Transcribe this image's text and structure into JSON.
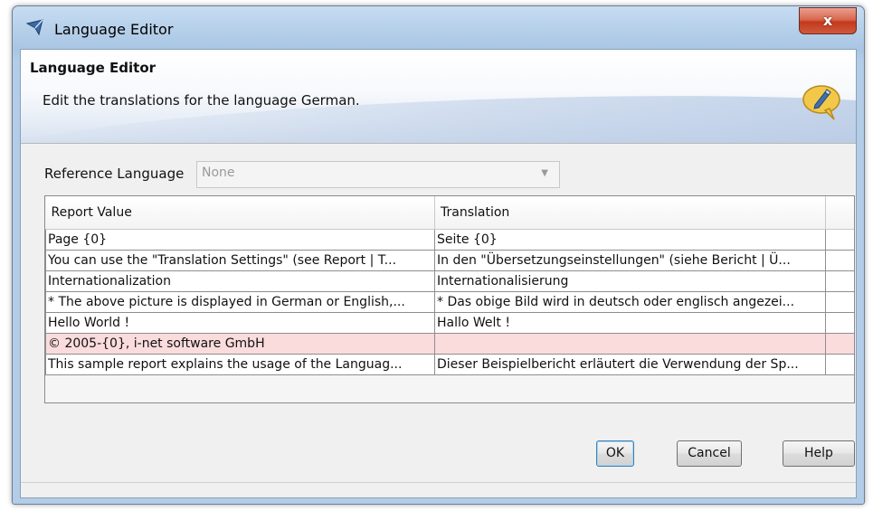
{
  "window": {
    "title": "Language Editor",
    "close_label": "x"
  },
  "banner": {
    "title": "Language Editor",
    "description": "Edit the translations for the language German."
  },
  "reference": {
    "label": "Reference Language",
    "value": "None"
  },
  "table": {
    "headers": [
      "Report Value",
      "Translation"
    ],
    "rows": [
      {
        "value": "Page {0}",
        "translation": "Seite {0}"
      },
      {
        "value": "You can use the \"Translation Settings\" (see Report | T...",
        "translation": "In den \"Übersetzungseinstellungen\" (siehe Bericht | Ü..."
      },
      {
        "value": "Internationalization",
        "translation": "Internationalisierung"
      },
      {
        "value": "* The above picture is displayed in German or English,...",
        "translation": "* Das obige Bild wird in deutsch oder englisch angezei..."
      },
      {
        "value": "Hello World !",
        "translation": "Hallo Welt !"
      },
      {
        "value": "© 2005-{0}, i-net software GmbH",
        "translation": ""
      },
      {
        "value": "This sample report explains the usage of the Languag...",
        "translation": "Dieser Beispielbericht erläutert die Verwendung der Sp..."
      }
    ],
    "highlight_color": "#fbdcdd"
  },
  "buttons": {
    "ok": "OK",
    "cancel": "Cancel",
    "help": "Help"
  },
  "colors": {
    "title_bar": "#b6d0ea",
    "close_button": "#c2391e",
    "ok_border": "#3c7fb1"
  },
  "icons": {
    "app": "language-editor-icon",
    "banner": "speech-bubble-icon"
  }
}
